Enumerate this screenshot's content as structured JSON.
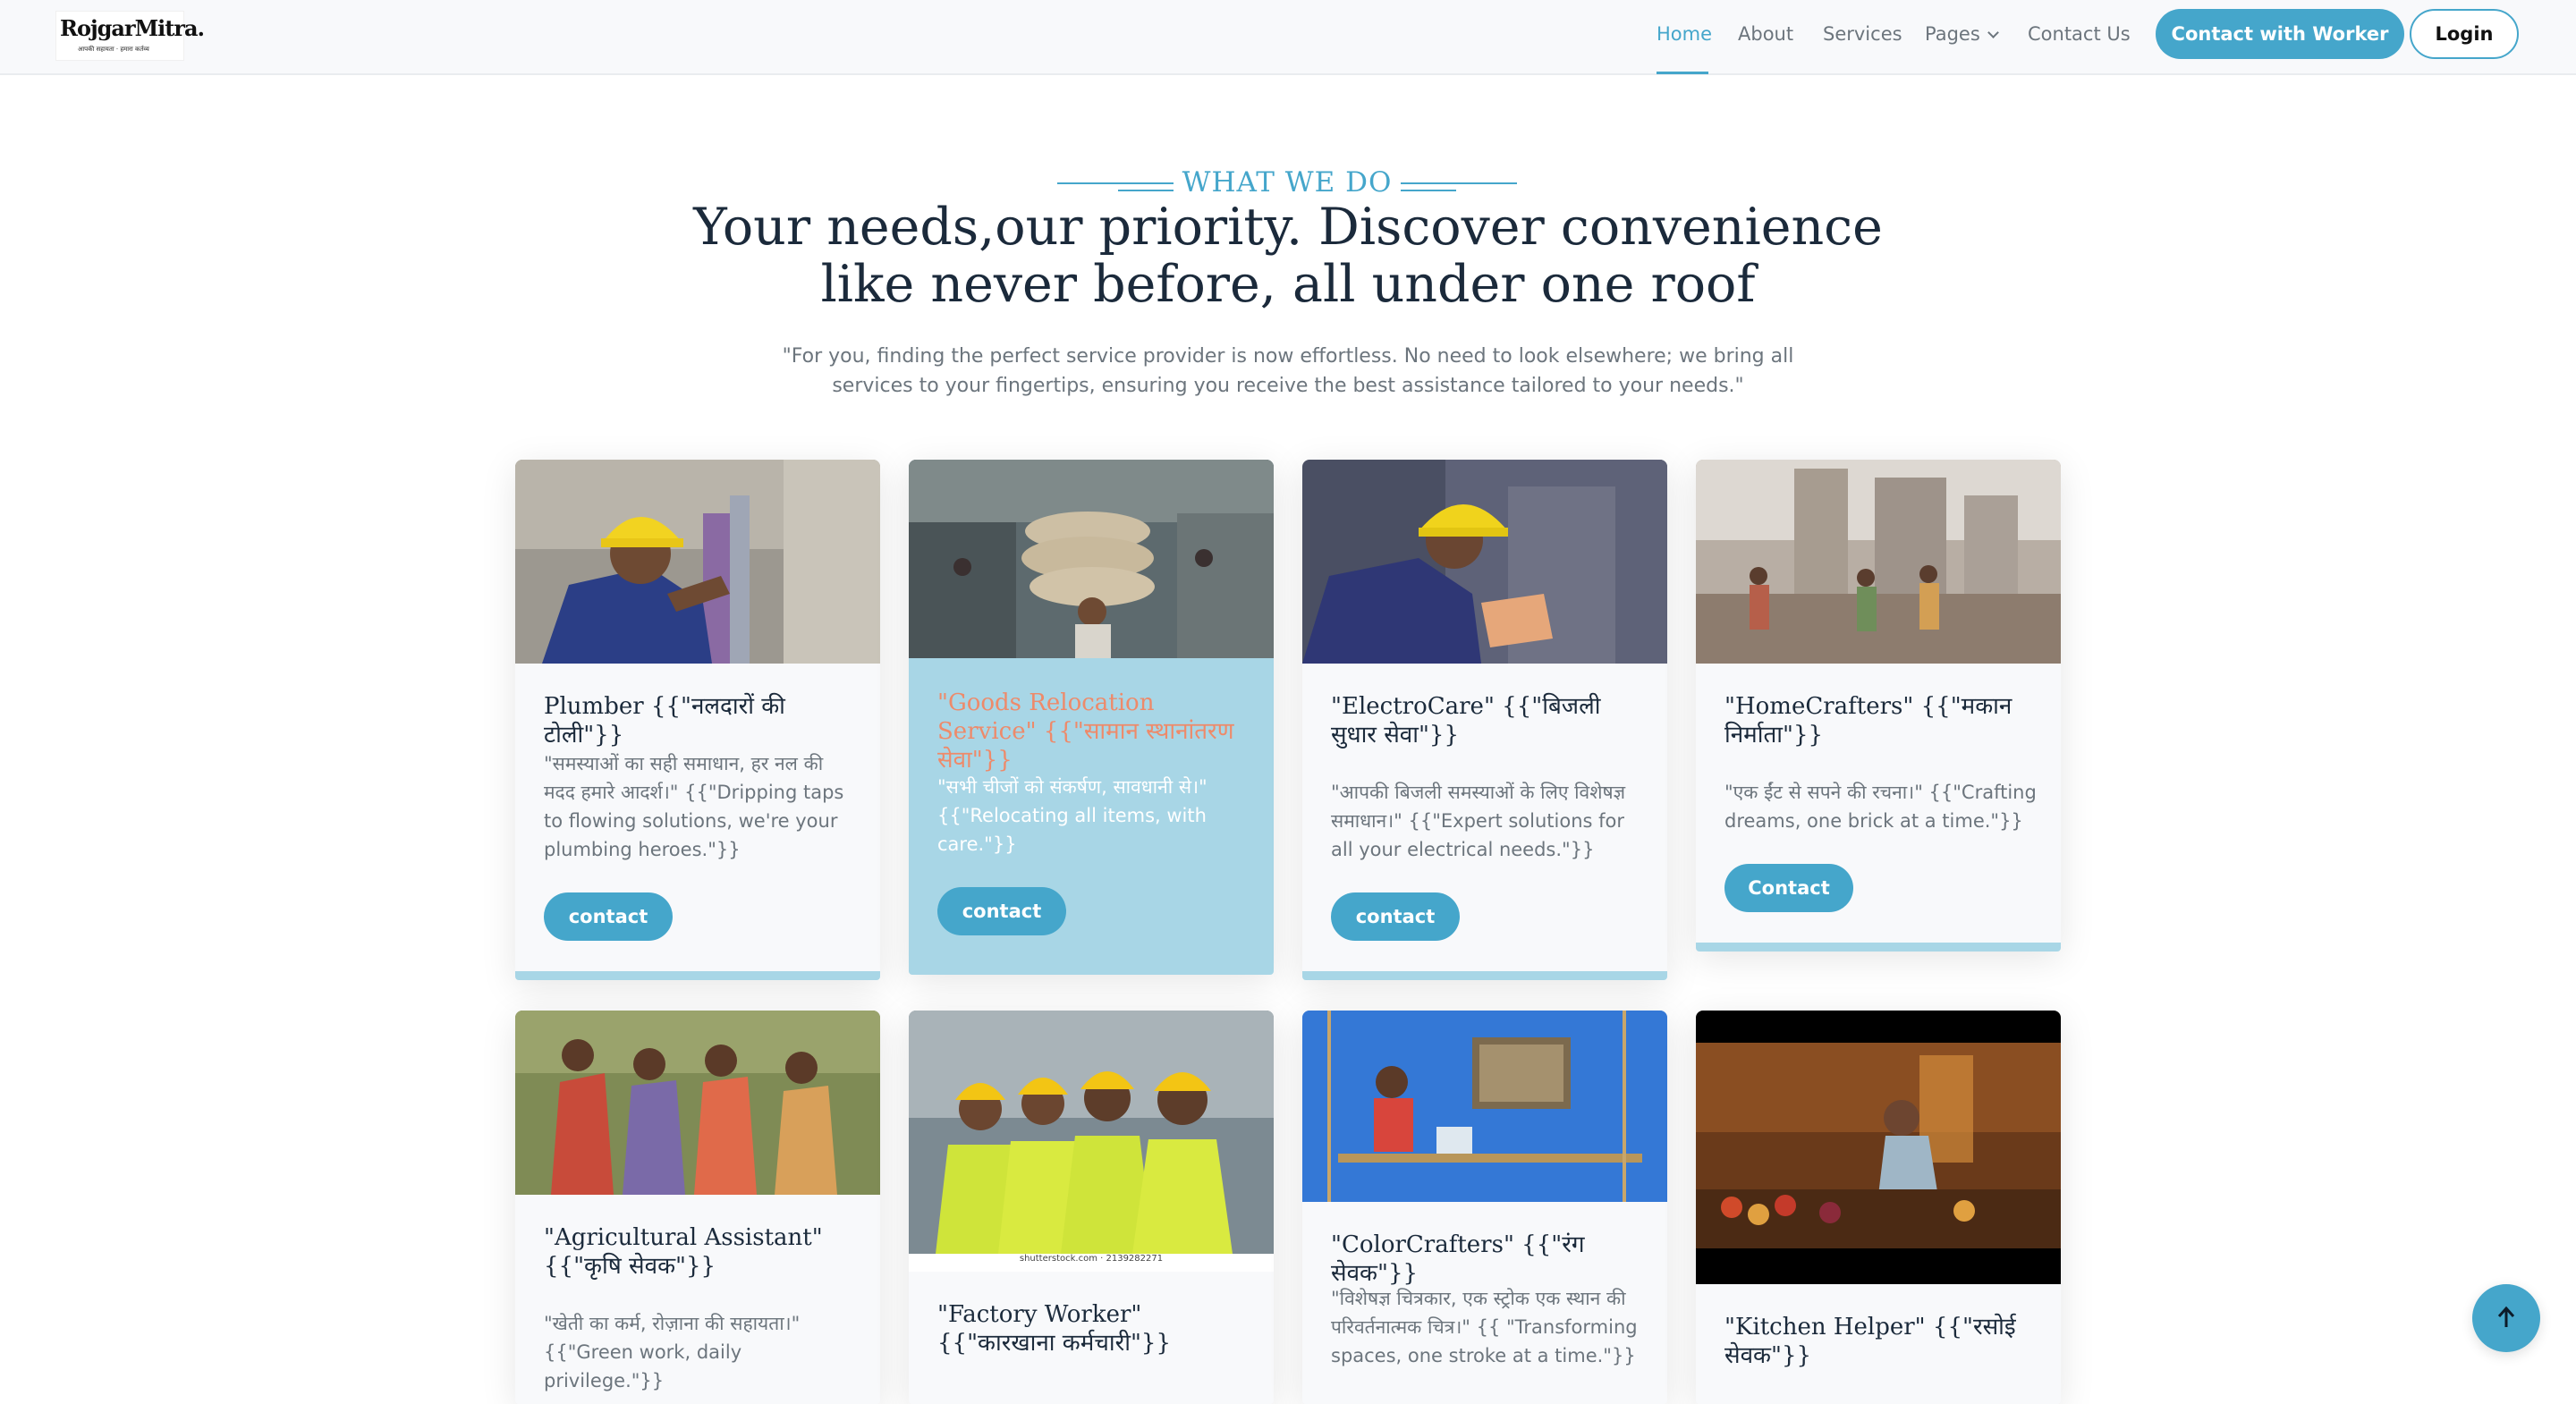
{
  "brand": {
    "name": "RojgarMitra.",
    "tagline": "आपकी सहायता · हमारा कर्तव्य"
  },
  "nav": {
    "items": [
      "Home",
      "About",
      "Services",
      "Pages",
      "Contact Us"
    ],
    "active": "Home",
    "cta_label": "Contact with Worker",
    "login_label": "Login"
  },
  "section": {
    "eyebrow": "WHAT WE DO",
    "title": "Your needs,our priority. Discover convenience like never before, all under one roof",
    "subtitle": "\"For you, finding the perfect service provider is now effortless. No need to look elsewhere; we bring all services to your fingertips, ensuring you receive the best assistance tailored to your needs.\""
  },
  "cards": [
    {
      "title": "Plumber {{\"नलदारों की टोली\"}}",
      "desc": "\"समस्याओं का सही समाधान, हर नल की मदद हमारे आदर्श।\" {{\"Dripping taps to flowing solutions, we're your plumbing heroes.\"}}",
      "button": "contact"
    },
    {
      "title": "\"Goods Relocation Service\" {{\"सामान स्थानांतरण सेवा\"}}",
      "desc": "\"सभी चीजों को संकर्षण, सावधानी से।\" {{\"Relocating all items, with care.\"}}",
      "button": "contact"
    },
    {
      "title": "\"ElectroCare\" {{\"बिजली सुधार सेवा\"}}",
      "desc": "\"आपकी बिजली समस्याओं के लिए विशेषज्ञ समाधान।\" {{\"Expert solutions for all your electrical needs.\"}}",
      "button": "contact"
    },
    {
      "title": "\"HomeCrafters\" {{\"मकान निर्माता\"}}",
      "desc": "\"एक ईंट से सपने की रचना।\" {{\"Crafting dreams, one brick at a time.\"}}",
      "button": "Contact"
    },
    {
      "title": "\"Agricultural Assistant\" {{\"कृषि सेवक\"}}",
      "desc": "\"खेती का कर्म, रोज़ाना की सहायता।\" {{\"Green work, daily privilege.\"}}",
      "button": ""
    },
    {
      "title": "\"Factory Worker\" {{\"कारखाना कर्मचारी\"}}",
      "desc": "",
      "image_caption": "shutterstock.com · 2139282271",
      "button": ""
    },
    {
      "title": "\"ColorCrafters\" {{\"रंग सेवक\"}}",
      "desc": "\"विशेषज्ञ चित्रकार, एक स्ट्रोक एक स्थान की परिवर्तनात्मक चित्र।\" {{ \"Transforming spaces, one stroke at a time.\"}}",
      "button": ""
    },
    {
      "title": "\"Kitchen Helper\" {{\"रसोई सेवक\"}}",
      "desc": "",
      "button": ""
    }
  ],
  "colors": {
    "accent": "#45a6cb",
    "featured_card": "#a8d6e6",
    "featured_title": "#ee8a6a",
    "heading": "#1b2a3b"
  },
  "icons": {
    "back_to_top": "arrow-up-icon",
    "pages_dropdown": "chevron-down-icon"
  }
}
